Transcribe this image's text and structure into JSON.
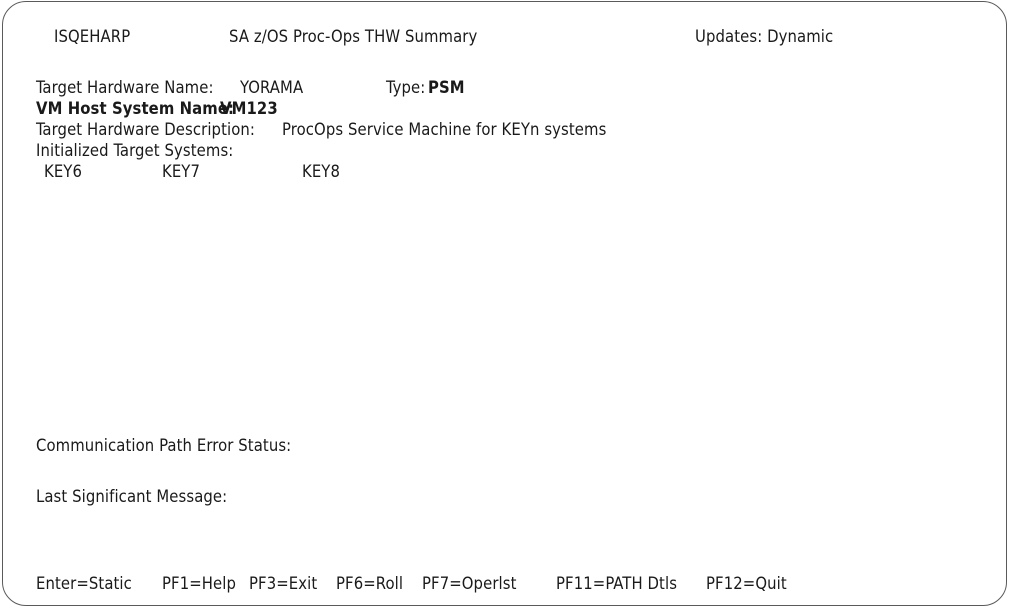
{
  "header": {
    "panel_id": "ISQEHARP",
    "title": "SA z/OS Proc-Ops THW Summary",
    "updates": "Updates: Dynamic"
  },
  "target": {
    "hw_name_label": "Target Hardware Name:",
    "hw_name_value": "YORAMA",
    "type_label": "Type:",
    "type_value": "PSM",
    "vm_host_label": "VM Host System Name:",
    "vm_host_value": "VM123",
    "description_label": "Target Hardware Description:",
    "description_value": "ProcOps Service Machine for KEYn systems",
    "init_systems_label": "Initialized Target Systems:",
    "systems": [
      "KEY6",
      "KEY7",
      "KEY8"
    ]
  },
  "status": {
    "comm_error_label": "Communication Path Error Status:",
    "last_message_label": "Last Significant Message:"
  },
  "footer": {
    "keys": [
      "Enter=Static",
      "PF1=Help",
      "PF3=Exit",
      "PF6=Roll",
      "PF7=Operlst",
      "PF11=PATH Dtls",
      "PF12=Quit"
    ]
  }
}
